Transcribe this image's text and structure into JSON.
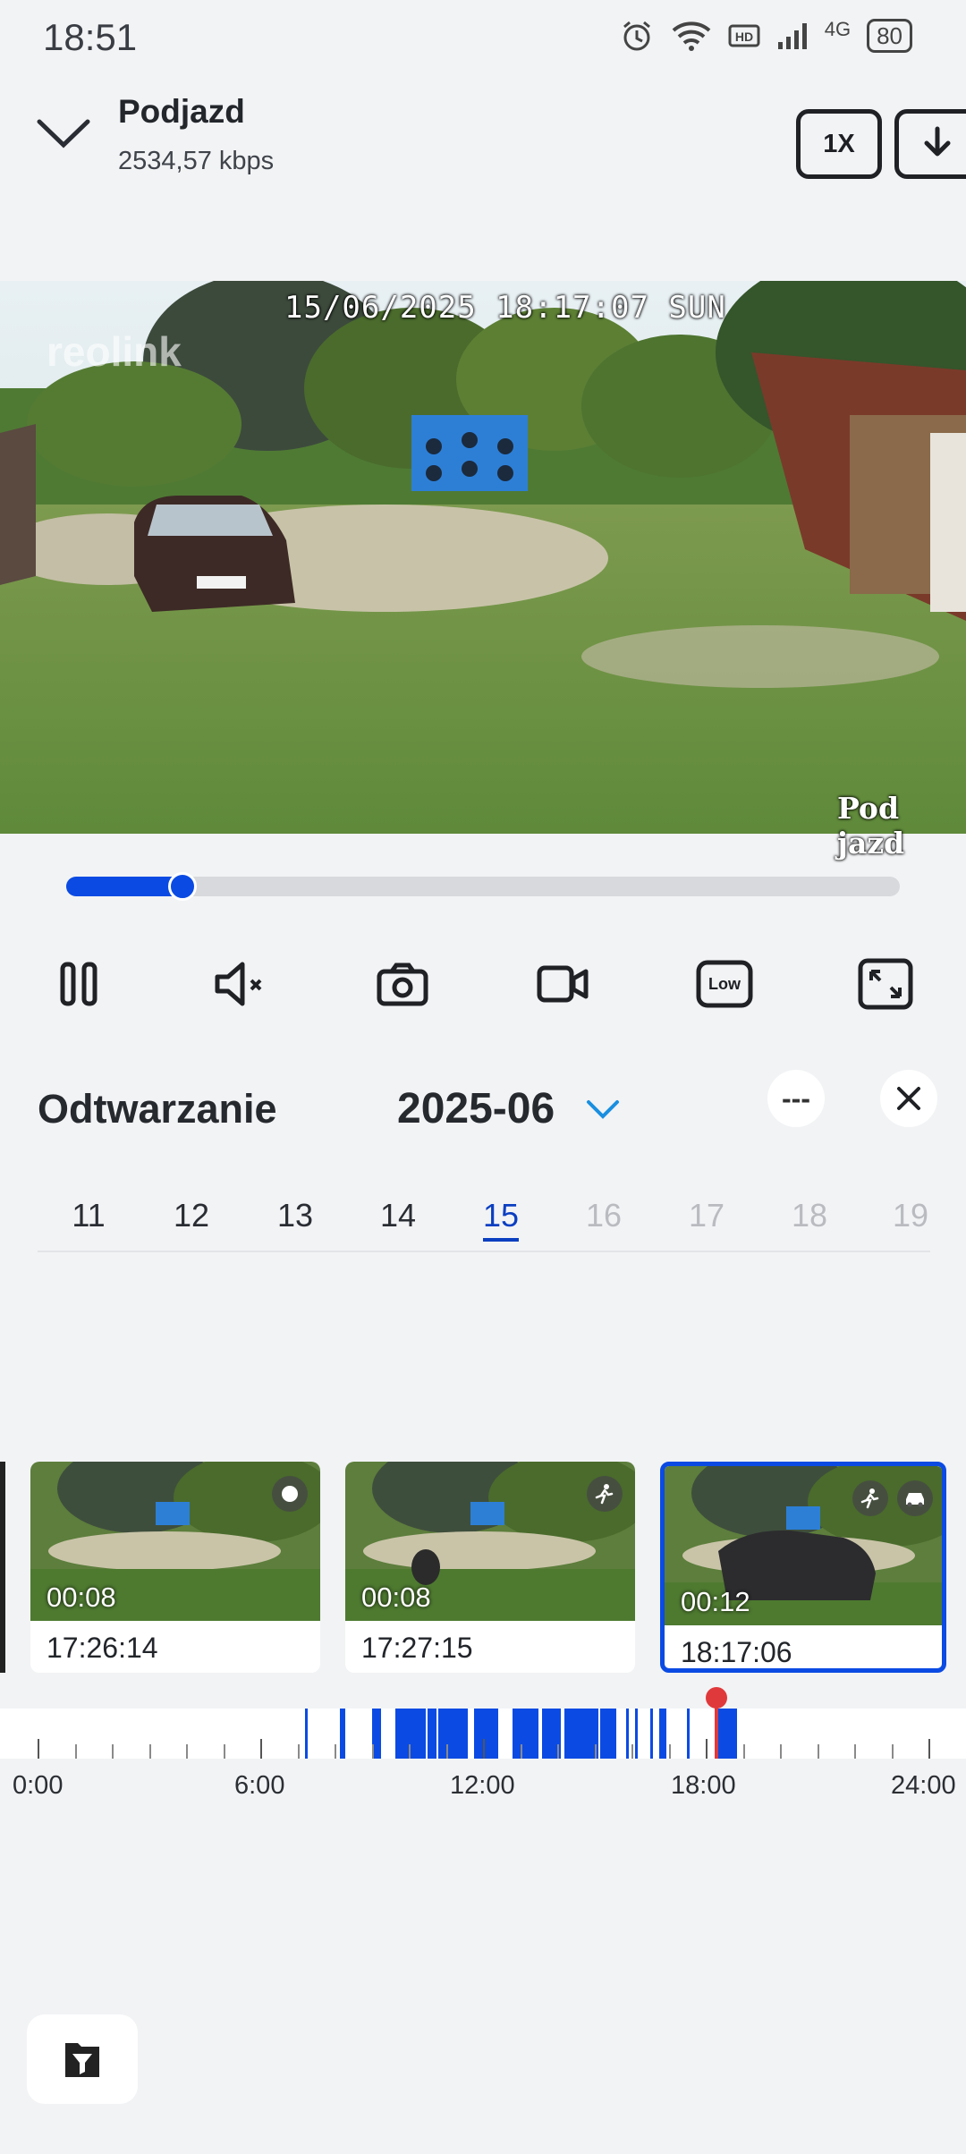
{
  "status_bar": {
    "time": "18:51",
    "network": "4G",
    "battery": "80"
  },
  "header": {
    "title": "Podjazd",
    "bitrate": "2534,57 kbps",
    "speed_label": "1X"
  },
  "video": {
    "osd_datetime": "15/06/2025 18:17:07 SUN",
    "osd_camera_name": "Pod jazd",
    "watermark": "reolink",
    "progress": 0.14
  },
  "controls": {
    "items": [
      {
        "icon": "pause-icon"
      },
      {
        "icon": "mute-icon"
      },
      {
        "icon": "snapshot-icon"
      },
      {
        "icon": "record-icon"
      },
      {
        "icon": "quality-low-icon",
        "label": "Low"
      },
      {
        "icon": "fullscreen-icon"
      }
    ]
  },
  "playback": {
    "title": "Odtwarzanie",
    "month": "2025-06",
    "more_label": "---",
    "days": [
      {
        "label": "11",
        "state": "enabled"
      },
      {
        "label": "12",
        "state": "enabled"
      },
      {
        "label": "13",
        "state": "enabled"
      },
      {
        "label": "14",
        "state": "enabled"
      },
      {
        "label": "15",
        "state": "selected"
      },
      {
        "label": "16",
        "state": "disabled"
      },
      {
        "label": "17",
        "state": "disabled"
      },
      {
        "label": "18",
        "state": "disabled"
      },
      {
        "label": "19",
        "state": "disabled"
      }
    ]
  },
  "clips": [
    {
      "duration": "00:08",
      "time": "17:26:14",
      "badges": [
        "other-icon"
      ],
      "selected": false
    },
    {
      "duration": "00:08",
      "time": "17:27:15",
      "badges": [
        "person-icon"
      ],
      "selected": false
    },
    {
      "duration": "00:12",
      "time": "18:17:06",
      "badges": [
        "person-icon",
        "vehicle-icon"
      ],
      "selected": true
    }
  ],
  "timeline": {
    "labels": [
      "0:00",
      "6:00",
      "12:00",
      "18:00",
      "24:00"
    ],
    "playhead_hour": 18.28,
    "recording_segments_hours": [
      [
        7.2,
        7.28
      ],
      [
        8.15,
        8.3
      ],
      [
        9.0,
        9.25
      ],
      [
        9.65,
        10.45
      ],
      [
        10.5,
        10.75
      ],
      [
        10.8,
        11.6
      ],
      [
        11.75,
        12.4
      ],
      [
        12.8,
        13.5
      ],
      [
        13.6,
        14.1
      ],
      [
        14.2,
        15.1
      ],
      [
        15.15,
        15.6
      ],
      [
        15.85,
        15.9
      ],
      [
        16.1,
        16.15
      ],
      [
        16.5,
        16.55
      ],
      [
        16.75,
        16.95
      ],
      [
        17.5,
        17.55
      ],
      [
        18.3,
        18.85
      ]
    ]
  },
  "colors": {
    "accent": "#0b4be3",
    "playhead": "#e0393b",
    "background": "#f2f3f5"
  }
}
